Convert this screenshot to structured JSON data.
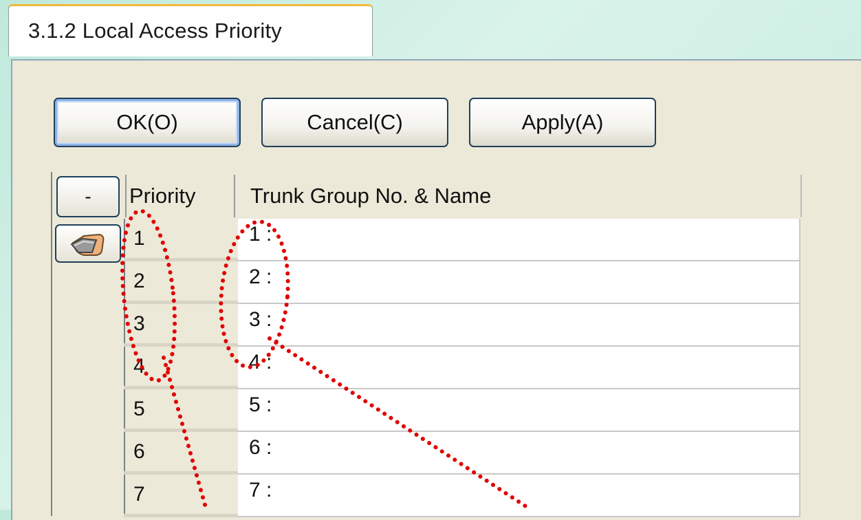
{
  "tab": {
    "title": "3.1.2 Local Access Priority"
  },
  "toolbar": {
    "ok_label": "OK(O)",
    "cancel_label": "Cancel(C)",
    "apply_label": "Apply(A)"
  },
  "grid": {
    "collapse_label": "-",
    "columns": {
      "priority": "Priority",
      "trunk": "Trunk Group No. & Name"
    },
    "rows": [
      {
        "priority": "1",
        "trunk": "1 :"
      },
      {
        "priority": "2",
        "trunk": "2 :"
      },
      {
        "priority": "3",
        "trunk": "3 :"
      },
      {
        "priority": "4",
        "trunk": "4 :"
      },
      {
        "priority": "5",
        "trunk": "5 :"
      },
      {
        "priority": "6",
        "trunk": "6 :"
      },
      {
        "priority": "7",
        "trunk": "7 :"
      }
    ]
  },
  "icons": {
    "row_indicator": "hand-pointer-icon"
  },
  "colors": {
    "annotation": "#e00000",
    "tab_accent": "#f2b73a",
    "panel_bg": "#ece9d8"
  }
}
